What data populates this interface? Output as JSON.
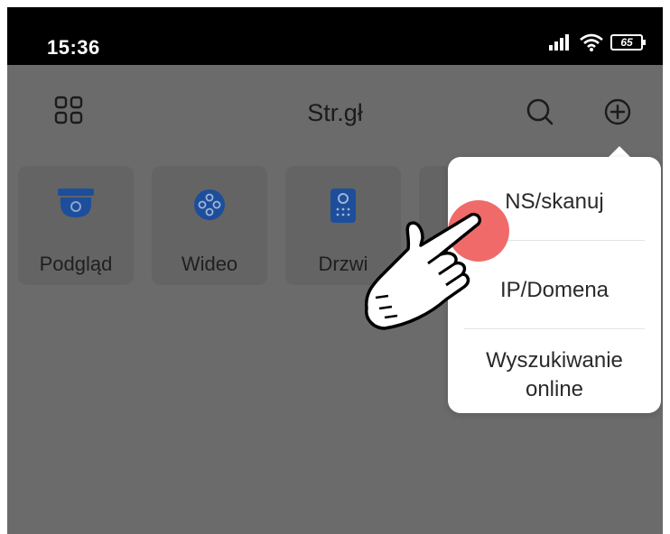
{
  "status_bar": {
    "time": "15:36",
    "battery": "65"
  },
  "header": {
    "title": "Str.gł",
    "left_icon": "grid-icon",
    "right_icons": [
      "search-icon",
      "add-icon"
    ]
  },
  "tiles": [
    {
      "label": "Podgląd",
      "icon": "dome-camera-icon"
    },
    {
      "label": "Wideo",
      "icon": "video-reel-icon"
    },
    {
      "label": "Drzwi",
      "icon": "door-intercom-icon"
    }
  ],
  "popup_menu": {
    "items": [
      {
        "label": "NS/skanuj"
      },
      {
        "label": "IP/Domena"
      },
      {
        "label_line1": "Wyszukiwanie",
        "label_line2": "online"
      }
    ]
  },
  "colors": {
    "overlay": "#6b6b6b",
    "status_bar": "#000000",
    "accent_blue": "#1d4e9c",
    "tap_dot": "#f06a6a",
    "menu_bg": "#ffffff"
  }
}
